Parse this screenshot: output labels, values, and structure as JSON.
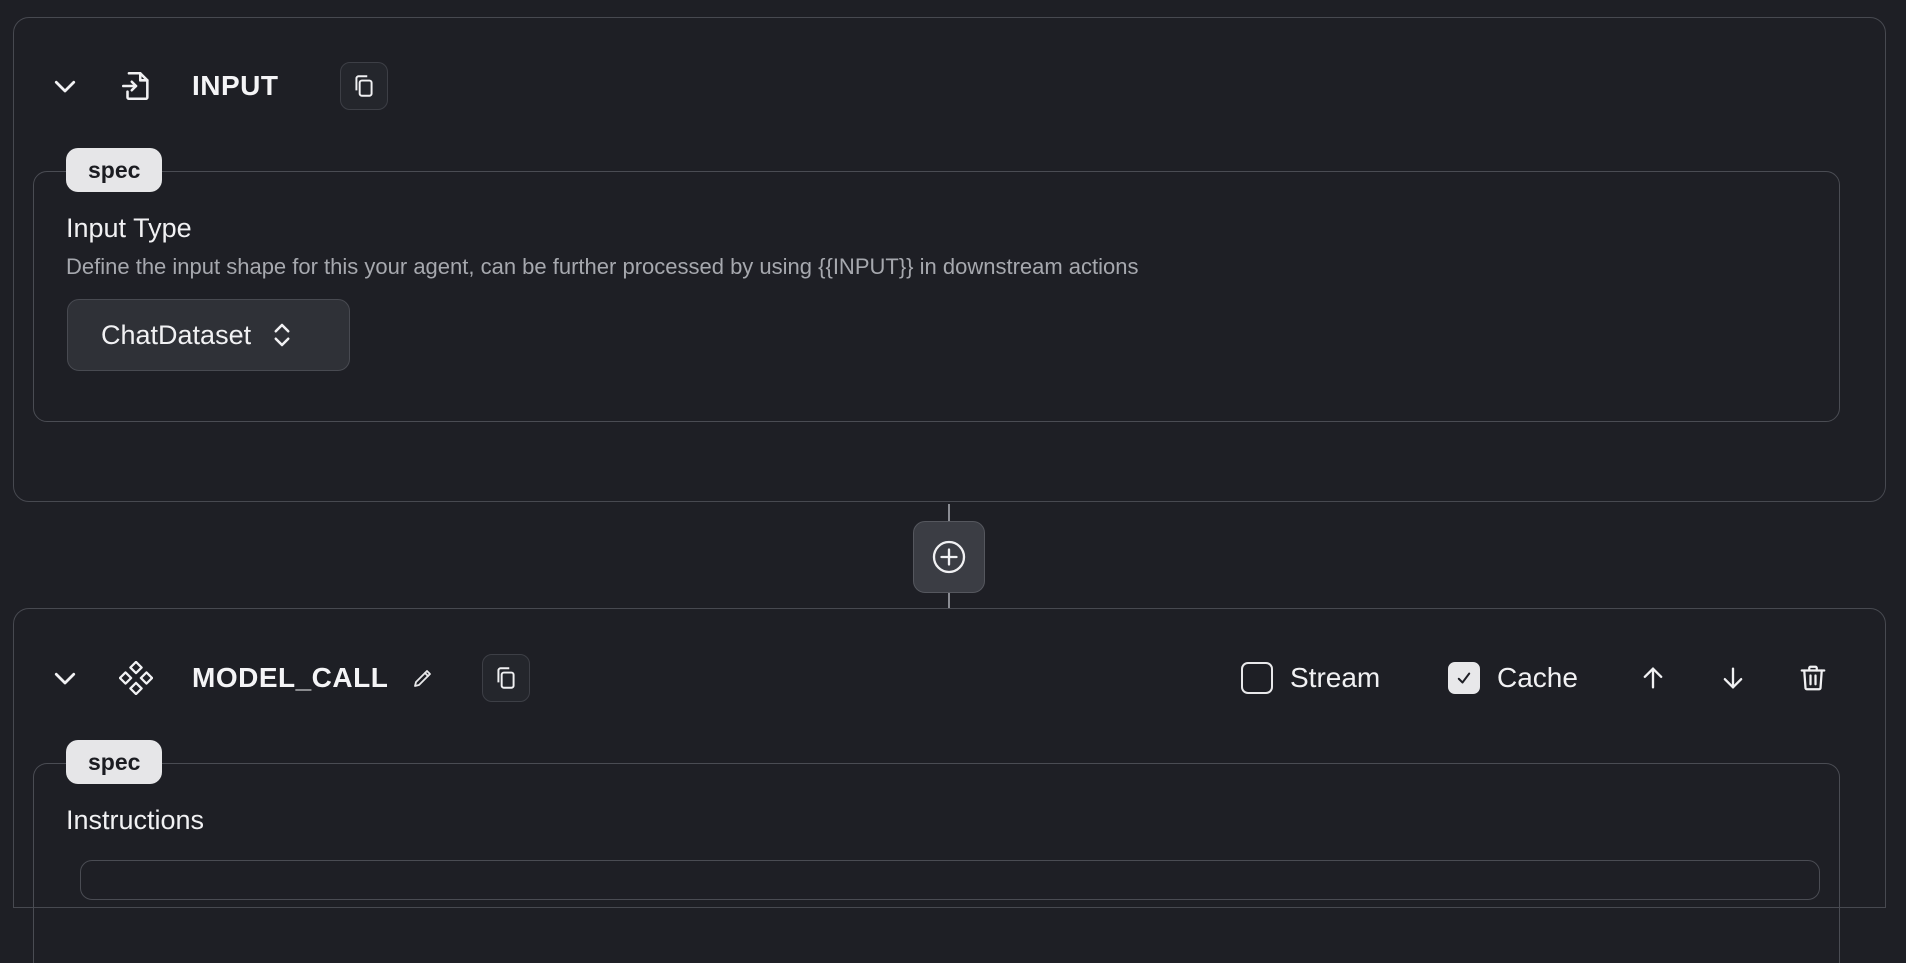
{
  "input_step": {
    "title": "INPUT",
    "spec_badge": "spec",
    "field_label": "Input Type",
    "field_description": "Define the input shape for this your agent, can be further processed by using {{INPUT}} in downstream actions",
    "selected_type": "ChatDataset",
    "icons": {
      "collapse": "chevron-down-icon",
      "type": "file-import-icon",
      "copy": "copy-icon",
      "selector": "chevron-up-down-icon"
    }
  },
  "add_step": {
    "icon": "plus-circle-icon"
  },
  "model_call_step": {
    "title": "MODEL_CALL",
    "spec_badge": "spec",
    "field_label": "Instructions",
    "stream_label": "Stream",
    "stream_checked": false,
    "cache_label": "Cache",
    "cache_checked": true,
    "icons": {
      "collapse": "chevron-down-icon",
      "type": "model-nodes-icon",
      "edit": "pencil-icon",
      "copy": "copy-icon",
      "move_up": "arrow-up-icon",
      "move_down": "arrow-down-icon",
      "delete": "trash-icon"
    }
  },
  "colors": {
    "background": "#1e1f25",
    "border": "#474950",
    "text": "#f1f1f3",
    "muted_text": "#a6a8ae",
    "badge_bg": "#e6e6e8"
  }
}
